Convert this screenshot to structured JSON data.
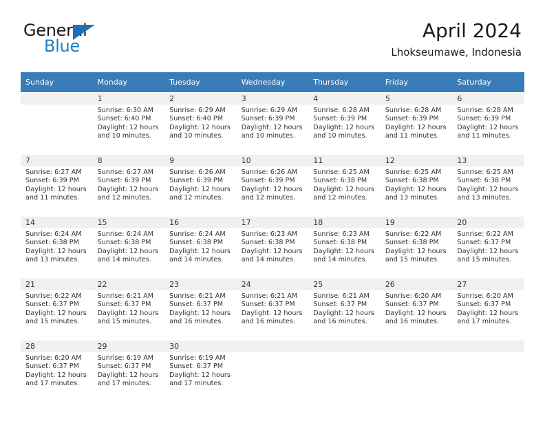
{
  "brand": {
    "name_part1": "General",
    "name_part2": "Blue",
    "triangle_color": "#1f6fb5",
    "blue_text_color": "#1f7fc4"
  },
  "header": {
    "title": "April 2024",
    "subtitle": "Lhokseumawe, Indonesia",
    "header_bg_color": "#3a7cb8",
    "header_text_color": "#ffffff"
  },
  "weekday_headers": [
    "Sunday",
    "Monday",
    "Tuesday",
    "Wednesday",
    "Thursday",
    "Friday",
    "Saturday"
  ],
  "labels": {
    "sunrise_prefix": "Sunrise:",
    "sunset_prefix": "Sunset:",
    "daylight_prefix": "Daylight:"
  },
  "weeks": [
    {
      "days": [
        {
          "number": "",
          "line1": "",
          "line2": "",
          "line3": "",
          "line4": ""
        },
        {
          "number": "1",
          "line1": "Sunrise: 6:30 AM",
          "line2": "Sunset: 6:40 PM",
          "line3": "Daylight: 12 hours",
          "line4": "and 10 minutes."
        },
        {
          "number": "2",
          "line1": "Sunrise: 6:29 AM",
          "line2": "Sunset: 6:40 PM",
          "line3": "Daylight: 12 hours",
          "line4": "and 10 minutes."
        },
        {
          "number": "3",
          "line1": "Sunrise: 6:29 AM",
          "line2": "Sunset: 6:39 PM",
          "line3": "Daylight: 12 hours",
          "line4": "and 10 minutes."
        },
        {
          "number": "4",
          "line1": "Sunrise: 6:28 AM",
          "line2": "Sunset: 6:39 PM",
          "line3": "Daylight: 12 hours",
          "line4": "and 10 minutes."
        },
        {
          "number": "5",
          "line1": "Sunrise: 6:28 AM",
          "line2": "Sunset: 6:39 PM",
          "line3": "Daylight: 12 hours",
          "line4": "and 11 minutes."
        },
        {
          "number": "6",
          "line1": "Sunrise: 6:28 AM",
          "line2": "Sunset: 6:39 PM",
          "line3": "Daylight: 12 hours",
          "line4": "and 11 minutes."
        }
      ]
    },
    {
      "days": [
        {
          "number": "7",
          "line1": "Sunrise: 6:27 AM",
          "line2": "Sunset: 6:39 PM",
          "line3": "Daylight: 12 hours",
          "line4": "and 11 minutes."
        },
        {
          "number": "8",
          "line1": "Sunrise: 6:27 AM",
          "line2": "Sunset: 6:39 PM",
          "line3": "Daylight: 12 hours",
          "line4": "and 12 minutes."
        },
        {
          "number": "9",
          "line1": "Sunrise: 6:26 AM",
          "line2": "Sunset: 6:39 PM",
          "line3": "Daylight: 12 hours",
          "line4": "and 12 minutes."
        },
        {
          "number": "10",
          "line1": "Sunrise: 6:26 AM",
          "line2": "Sunset: 6:39 PM",
          "line3": "Daylight: 12 hours",
          "line4": "and 12 minutes."
        },
        {
          "number": "11",
          "line1": "Sunrise: 6:25 AM",
          "line2": "Sunset: 6:38 PM",
          "line3": "Daylight: 12 hours",
          "line4": "and 12 minutes."
        },
        {
          "number": "12",
          "line1": "Sunrise: 6:25 AM",
          "line2": "Sunset: 6:38 PM",
          "line3": "Daylight: 12 hours",
          "line4": "and 13 minutes."
        },
        {
          "number": "13",
          "line1": "Sunrise: 6:25 AM",
          "line2": "Sunset: 6:38 PM",
          "line3": "Daylight: 12 hours",
          "line4": "and 13 minutes."
        }
      ]
    },
    {
      "days": [
        {
          "number": "14",
          "line1": "Sunrise: 6:24 AM",
          "line2": "Sunset: 6:38 PM",
          "line3": "Daylight: 12 hours",
          "line4": "and 13 minutes."
        },
        {
          "number": "15",
          "line1": "Sunrise: 6:24 AM",
          "line2": "Sunset: 6:38 PM",
          "line3": "Daylight: 12 hours",
          "line4": "and 14 minutes."
        },
        {
          "number": "16",
          "line1": "Sunrise: 6:24 AM",
          "line2": "Sunset: 6:38 PM",
          "line3": "Daylight: 12 hours",
          "line4": "and 14 minutes."
        },
        {
          "number": "17",
          "line1": "Sunrise: 6:23 AM",
          "line2": "Sunset: 6:38 PM",
          "line3": "Daylight: 12 hours",
          "line4": "and 14 minutes."
        },
        {
          "number": "18",
          "line1": "Sunrise: 6:23 AM",
          "line2": "Sunset: 6:38 PM",
          "line3": "Daylight: 12 hours",
          "line4": "and 14 minutes."
        },
        {
          "number": "19",
          "line1": "Sunrise: 6:22 AM",
          "line2": "Sunset: 6:38 PM",
          "line3": "Daylight: 12 hours",
          "line4": "and 15 minutes."
        },
        {
          "number": "20",
          "line1": "Sunrise: 6:22 AM",
          "line2": "Sunset: 6:37 PM",
          "line3": "Daylight: 12 hours",
          "line4": "and 15 minutes."
        }
      ]
    },
    {
      "days": [
        {
          "number": "21",
          "line1": "Sunrise: 6:22 AM",
          "line2": "Sunset: 6:37 PM",
          "line3": "Daylight: 12 hours",
          "line4": "and 15 minutes."
        },
        {
          "number": "22",
          "line1": "Sunrise: 6:21 AM",
          "line2": "Sunset: 6:37 PM",
          "line3": "Daylight: 12 hours",
          "line4": "and 15 minutes."
        },
        {
          "number": "23",
          "line1": "Sunrise: 6:21 AM",
          "line2": "Sunset: 6:37 PM",
          "line3": "Daylight: 12 hours",
          "line4": "and 16 minutes."
        },
        {
          "number": "24",
          "line1": "Sunrise: 6:21 AM",
          "line2": "Sunset: 6:37 PM",
          "line3": "Daylight: 12 hours",
          "line4": "and 16 minutes."
        },
        {
          "number": "25",
          "line1": "Sunrise: 6:21 AM",
          "line2": "Sunset: 6:37 PM",
          "line3": "Daylight: 12 hours",
          "line4": "and 16 minutes."
        },
        {
          "number": "26",
          "line1": "Sunrise: 6:20 AM",
          "line2": "Sunset: 6:37 PM",
          "line3": "Daylight: 12 hours",
          "line4": "and 16 minutes."
        },
        {
          "number": "27",
          "line1": "Sunrise: 6:20 AM",
          "line2": "Sunset: 6:37 PM",
          "line3": "Daylight: 12 hours",
          "line4": "and 17 minutes."
        }
      ]
    },
    {
      "days": [
        {
          "number": "28",
          "line1": "Sunrise: 6:20 AM",
          "line2": "Sunset: 6:37 PM",
          "line3": "Daylight: 12 hours",
          "line4": "and 17 minutes."
        },
        {
          "number": "29",
          "line1": "Sunrise: 6:19 AM",
          "line2": "Sunset: 6:37 PM",
          "line3": "Daylight: 12 hours",
          "line4": "and 17 minutes."
        },
        {
          "number": "30",
          "line1": "Sunrise: 6:19 AM",
          "line2": "Sunset: 6:37 PM",
          "line3": "Daylight: 12 hours",
          "line4": "and 17 minutes."
        },
        {
          "number": "",
          "line1": "",
          "line2": "",
          "line3": "",
          "line4": ""
        },
        {
          "number": "",
          "line1": "",
          "line2": "",
          "line3": "",
          "line4": ""
        },
        {
          "number": "",
          "line1": "",
          "line2": "",
          "line3": "",
          "line4": ""
        },
        {
          "number": "",
          "line1": "",
          "line2": "",
          "line3": "",
          "line4": ""
        }
      ]
    }
  ]
}
